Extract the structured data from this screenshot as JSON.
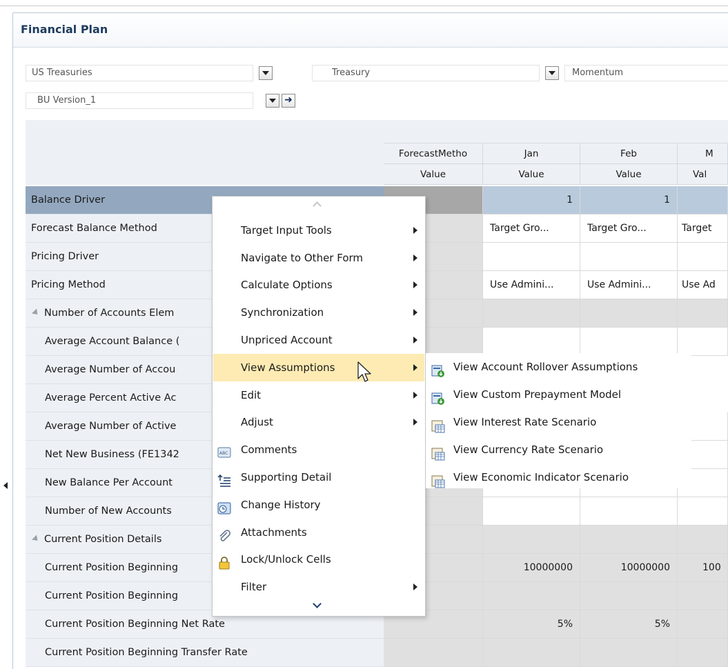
{
  "form": {
    "title": "Financial Plan"
  },
  "pov": {
    "entity": "US Treasuries",
    "product": "Treasury",
    "scenario": "Momentum",
    "version": "BU Version_1"
  },
  "grid": {
    "columns": [
      {
        "top": "ForecastMetho",
        "bottom": "Value"
      },
      {
        "top": "Jan",
        "bottom": "Value"
      },
      {
        "top": "Feb",
        "bottom": "Value"
      },
      {
        "top": "M",
        "bottom": "Val"
      }
    ],
    "rows": [
      {
        "label": "Balance Driver",
        "cells": [
          "",
          "1",
          "1",
          ""
        ]
      },
      {
        "label": "Forecast Balance Method",
        "cells": [
          "",
          "Target Gro...",
          "Target Gro...",
          "Target"
        ]
      },
      {
        "label": "Pricing Driver",
        "cells": [
          "",
          "",
          "",
          ""
        ]
      },
      {
        "label": "Pricing Method",
        "cells": [
          "",
          "Use Admini...",
          "Use Admini...",
          "Use Ad"
        ]
      },
      {
        "label": "Number of Accounts Elem",
        "cells": [
          "",
          "",
          "",
          ""
        ]
      },
      {
        "label": "Average Account Balance (",
        "cells": [
          "",
          "",
          "",
          ""
        ]
      },
      {
        "label": "Average Number of Accou",
        "cells": [
          "",
          "",
          "",
          ""
        ]
      },
      {
        "label": "Average Percent Active Ac",
        "cells": [
          "",
          "",
          "",
          ""
        ]
      },
      {
        "label": "Average Number of Active",
        "cells": [
          "",
          "",
          "",
          ""
        ]
      },
      {
        "label": "Net New Business (FE1342",
        "cells": [
          "",
          "",
          "",
          ""
        ]
      },
      {
        "label": "New Balance Per Account",
        "cells": [
          "",
          "",
          "",
          ""
        ]
      },
      {
        "label": "Number of New Accounts",
        "cells": [
          "",
          "",
          "",
          ""
        ]
      },
      {
        "label": "Current Position Details",
        "cells": [
          "",
          "",
          "",
          ""
        ]
      },
      {
        "label": "Current Position Beginning",
        "cells": [
          "",
          "10000000",
          "10000000",
          "100"
        ]
      },
      {
        "label": "Current Position Beginning",
        "cells": [
          "",
          "",
          "",
          ""
        ]
      },
      {
        "label": "Current Position Beginning Net Rate",
        "cells": [
          "",
          "5%",
          "5%",
          ""
        ]
      },
      {
        "label": "Current Position Beginning Transfer Rate",
        "cells": [
          "",
          "",
          "",
          ""
        ]
      }
    ]
  },
  "context_menu": {
    "items": [
      {
        "label": "Target Input Tools",
        "icon": "",
        "submenu": true
      },
      {
        "label": "Navigate to Other Form",
        "icon": "",
        "submenu": true
      },
      {
        "label": "Calculate Options",
        "icon": "",
        "submenu": true
      },
      {
        "label": "Synchronization",
        "icon": "",
        "submenu": true
      },
      {
        "label": "Unpriced Account",
        "icon": "",
        "submenu": true
      },
      {
        "label": "View Assumptions",
        "icon": "",
        "submenu": true
      },
      {
        "label": "Edit",
        "icon": "",
        "submenu": true
      },
      {
        "label": "Adjust",
        "icon": "",
        "submenu": true
      },
      {
        "label": "Comments",
        "icon": "comments-icon",
        "submenu": false
      },
      {
        "label": "Supporting Detail",
        "icon": "supporting-detail-icon",
        "submenu": false
      },
      {
        "label": "Change History",
        "icon": "change-history-icon",
        "submenu": false
      },
      {
        "label": "Attachments",
        "icon": "paperclip-icon",
        "submenu": false
      },
      {
        "label": "Lock/Unlock Cells",
        "icon": "lock-icon",
        "submenu": false
      },
      {
        "label": "Filter",
        "icon": "",
        "submenu": true
      }
    ]
  },
  "submenu": {
    "items": [
      {
        "label": "View Account Rollover Assumptions",
        "icon": "view-assumption-icon"
      },
      {
        "label": "View Custom Prepayment Model",
        "icon": "view-assumption-icon"
      },
      {
        "label": "View Interest Rate Scenario",
        "icon": "view-scenario-icon"
      },
      {
        "label": "View Currency Rate Scenario",
        "icon": "view-scenario-icon"
      },
      {
        "label": "View Economic Indicator Scenario",
        "icon": "view-scenario-icon"
      }
    ]
  },
  "colors": {
    "title": "#1d3b5e",
    "selected_row": "#93a8bf",
    "menu_highlight": "#fdebb3",
    "header_bg": "#edf1f5"
  }
}
